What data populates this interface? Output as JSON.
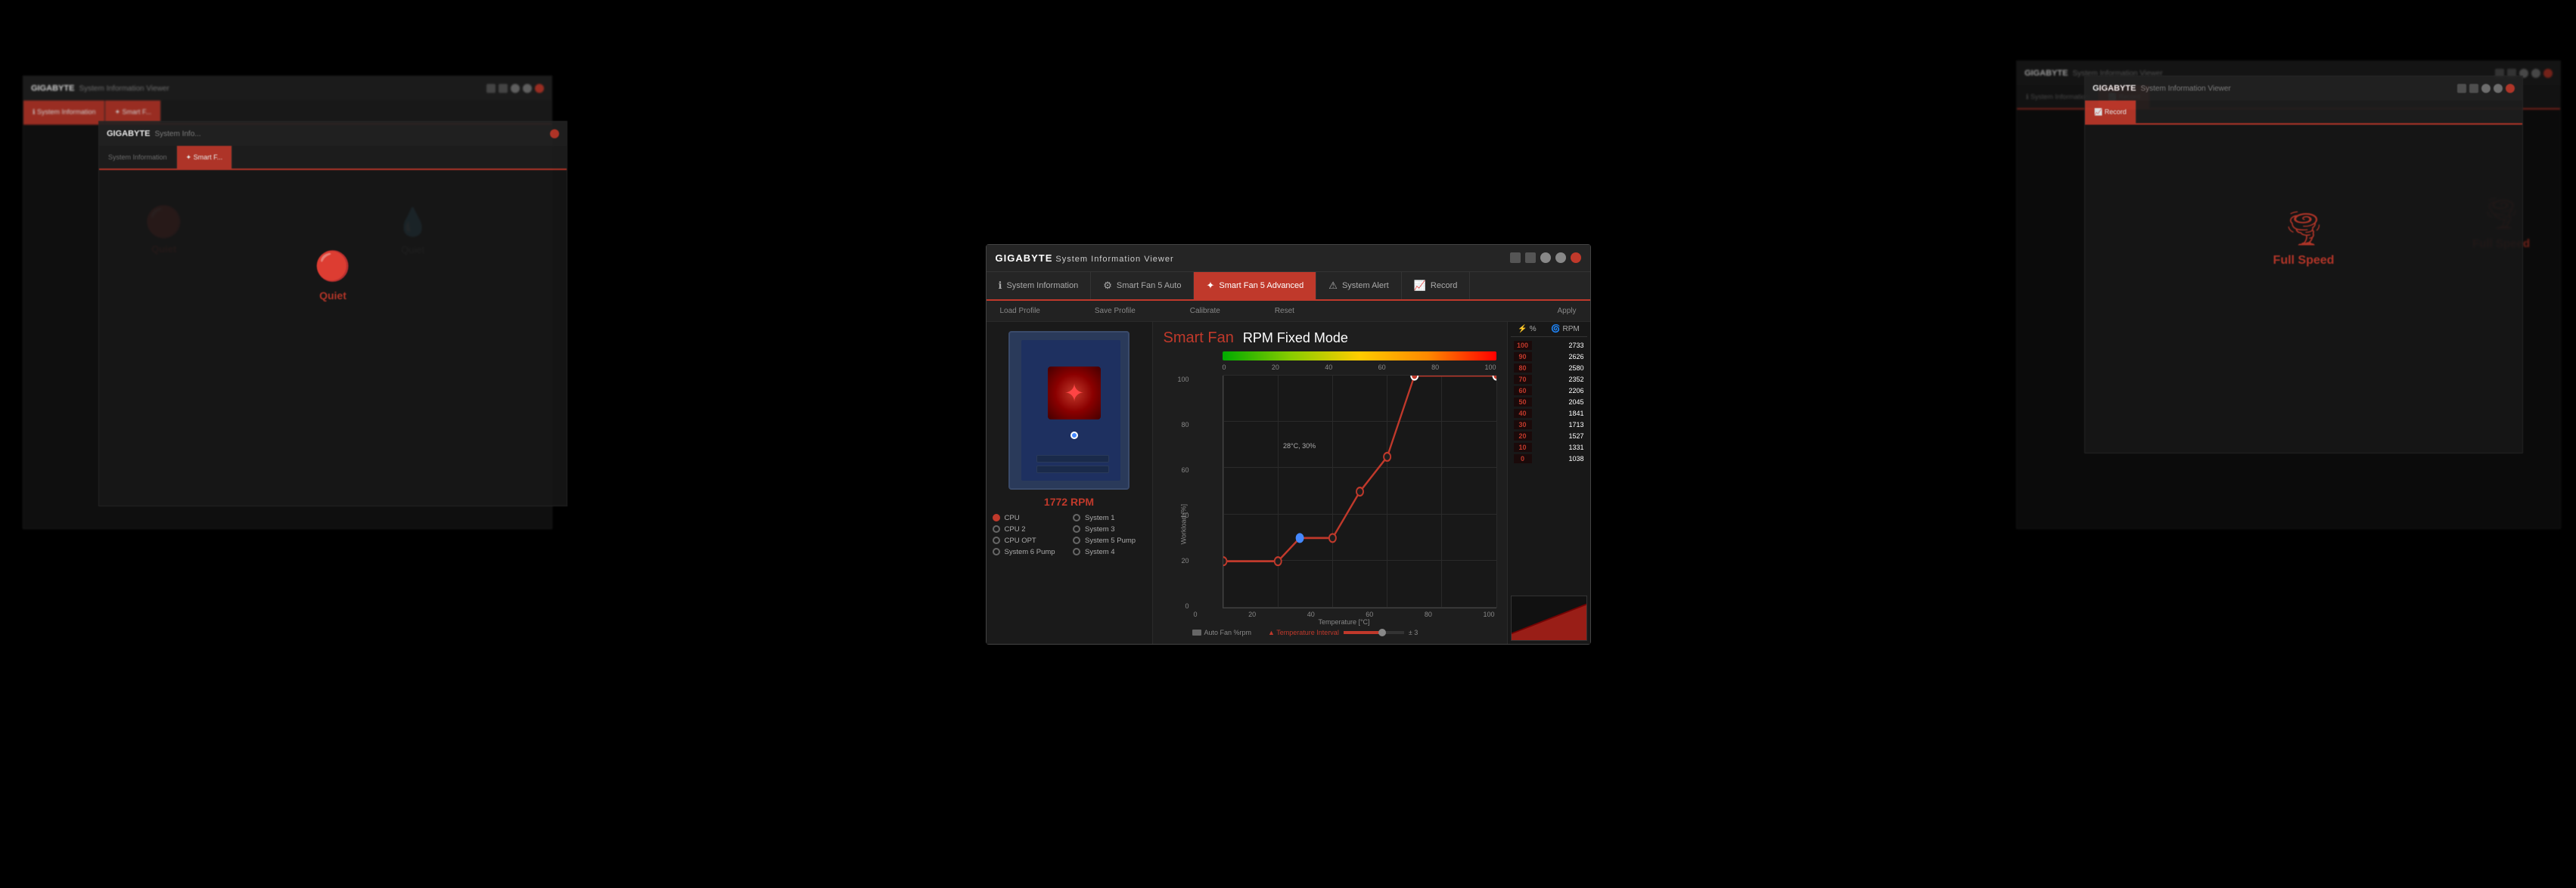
{
  "app": {
    "title": "GIGABYTE System Information Viewer",
    "brand": "GIGABYTE",
    "subtitle": "System Information Viewer"
  },
  "tabs": [
    {
      "id": "system-info",
      "label": "System Information",
      "icon": "ℹ",
      "active": false
    },
    {
      "id": "smart-fan-auto",
      "label": "Smart Fan 5 Auto",
      "icon": "⚙",
      "active": false
    },
    {
      "id": "smart-fan-advanced",
      "label": "Smart Fan 5 Advanced",
      "icon": "✦",
      "active": true
    },
    {
      "id": "system-alert",
      "label": "System Alert",
      "icon": "⚠",
      "active": false
    },
    {
      "id": "record",
      "label": "Record",
      "icon": "📈",
      "active": false
    }
  ],
  "toolbar": {
    "load_profile": "Load Profile",
    "save_profile": "Save Profile",
    "calibrate": "Calibrate",
    "reset": "Reset",
    "apply": "Apply"
  },
  "fan": {
    "rpm": "1772 RPM",
    "chart_title_1": "Smart Fan",
    "chart_title_2": "RPM Fixed Mode",
    "mode_label": "RPM Fixed Mode"
  },
  "sensors": [
    {
      "id": "cpu",
      "label": "CPU",
      "active": true
    },
    {
      "id": "cpu2",
      "label": "CPU 2",
      "active": false
    },
    {
      "id": "cpu-opt",
      "label": "CPU OPT",
      "active": false
    },
    {
      "id": "system6-pump",
      "label": "System 6 Pump",
      "active": false
    },
    {
      "id": "system1",
      "label": "System 1",
      "active": false
    },
    {
      "id": "system3",
      "label": "System 3",
      "active": false
    },
    {
      "id": "system5-pump",
      "label": "System 5 Pump",
      "active": false
    },
    {
      "id": "system4",
      "label": "System 4",
      "active": false
    }
  ],
  "chart": {
    "y_axis_title": "Workload [%]",
    "x_axis_title": "Temperature [°C]",
    "x_labels": [
      "0",
      "20",
      "40",
      "60",
      "80",
      "100"
    ],
    "y_labels": [
      "0",
      "20",
      "40",
      "60",
      "80",
      "100"
    ],
    "tooltip_text": "28°C, 30%",
    "temp_bar_labels": [
      "0",
      "20",
      "40",
      "60",
      "80",
      "100"
    ]
  },
  "rpm_table": {
    "header_percent": "%",
    "header_rpm": "RPM",
    "rows": [
      {
        "percent": "100",
        "rpm": "2733"
      },
      {
        "percent": "90",
        "rpm": "2626"
      },
      {
        "percent": "80",
        "rpm": "2580"
      },
      {
        "percent": "70",
        "rpm": "2352"
      },
      {
        "percent": "60",
        "rpm": "2206"
      },
      {
        "percent": "50",
        "rpm": "2045"
      },
      {
        "percent": "40",
        "rpm": "1841"
      },
      {
        "percent": "30",
        "rpm": "1713"
      },
      {
        "percent": "20",
        "rpm": "1527"
      },
      {
        "percent": "10",
        "rpm": "1331"
      },
      {
        "percent": "0",
        "rpm": "1038"
      }
    ]
  },
  "bottom": {
    "legend_auto_fan": "Auto Fan %rpm",
    "legend_temp_interval": "▲ Temperature Interval",
    "slider_value": "± 3"
  },
  "title_controls": {
    "settings": "⚙",
    "list": "≡",
    "minimize": "–",
    "maximize": "□",
    "close": "✕"
  },
  "bg_left": {
    "title": "GIGABYTE System Information Viewer",
    "tab1": "System Information",
    "tab2": "Smart F...",
    "mode": "Quiet",
    "mode2": "Quiet"
  },
  "bg_right": {
    "title": "GIGABYTE System Information Viewer",
    "tab1": "Record",
    "mode": "Full Speed"
  }
}
